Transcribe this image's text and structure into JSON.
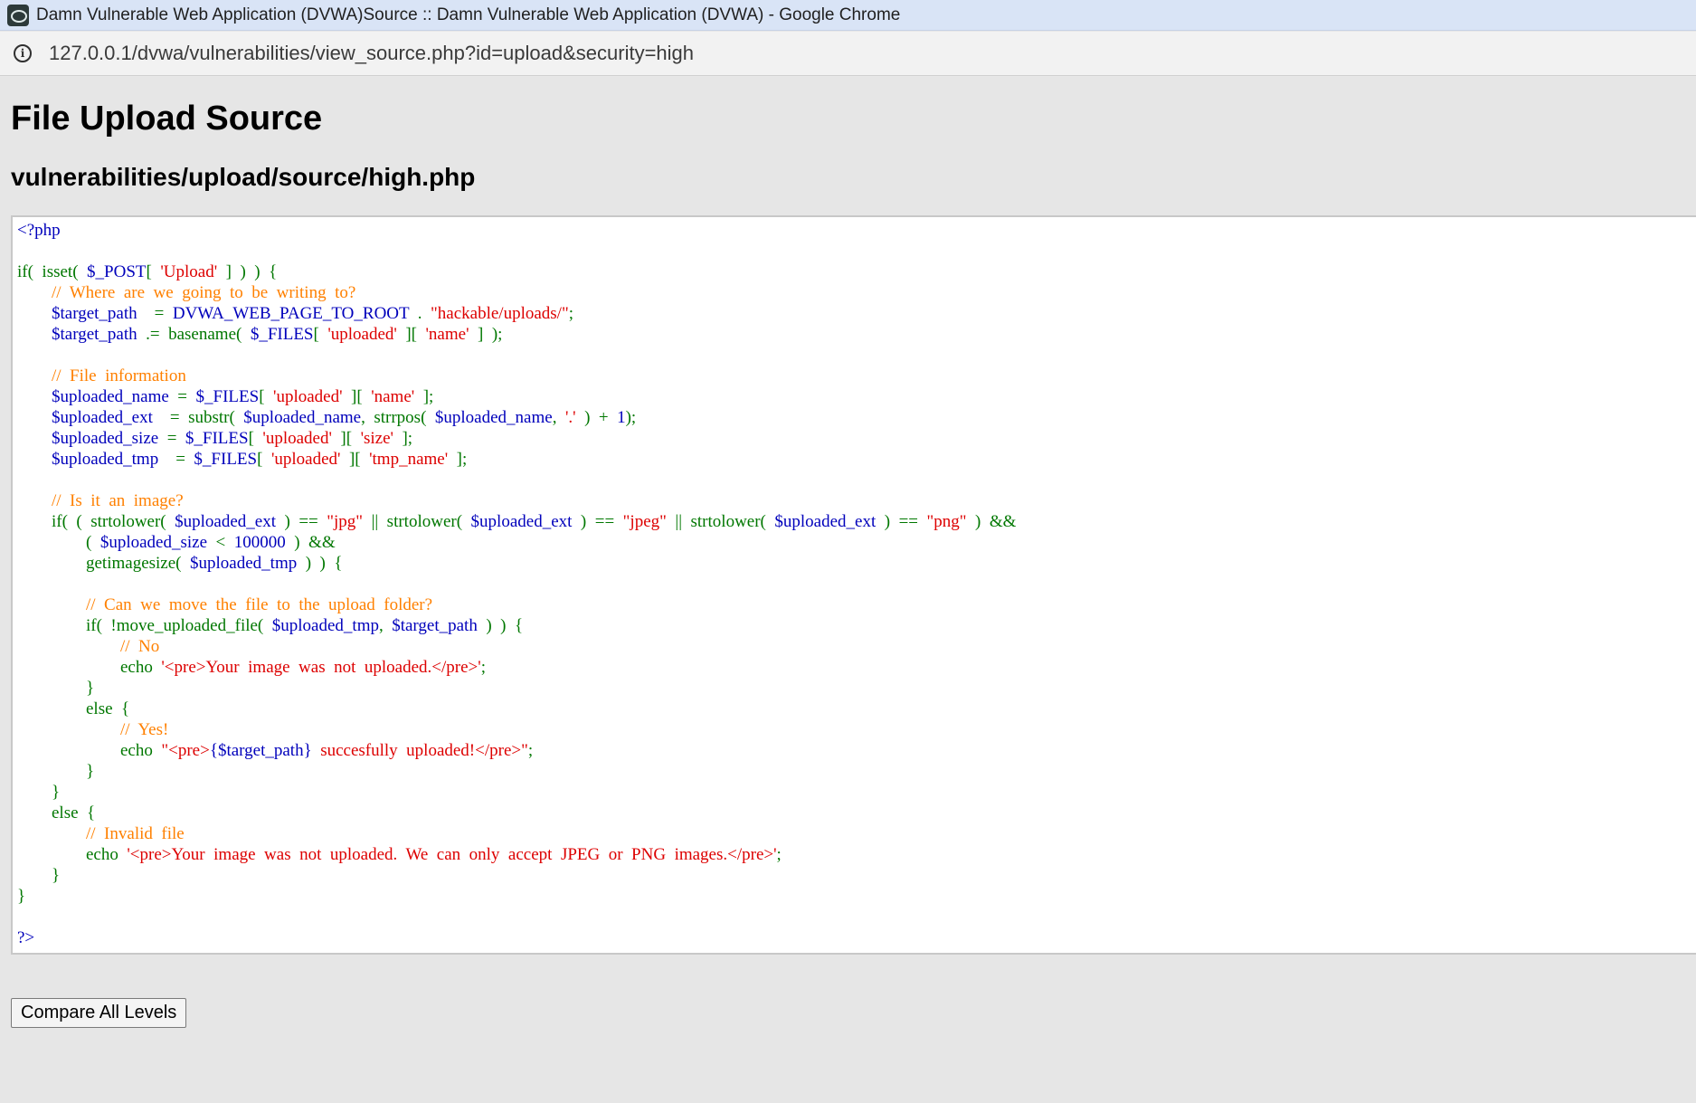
{
  "window": {
    "title": "Damn Vulnerable Web Application (DVWA)Source :: Damn Vulnerable Web Application (DVWA) - Google Chrome"
  },
  "address_bar": {
    "url": "127.0.0.1/dvwa/vulnerabilities/view_source.php?id=upload&security=high"
  },
  "page": {
    "heading": "File Upload Source",
    "subheading": "vulnerabilities/upload/source/high.php",
    "compare_button": "Compare All Levels"
  },
  "source_code": [
    [
      [
        "var",
        "<?php"
      ]
    ],
    [],
    [
      [
        "kw",
        "if(  isset(  "
      ],
      [
        "var",
        "$_POST"
      ],
      [
        "kw",
        "[  "
      ],
      [
        "str",
        "'Upload'"
      ],
      [
        "kw",
        "  ]  )  )  {"
      ]
    ],
    [
      [
        "kw",
        "        "
      ],
      [
        "cm",
        "//  Where  are  we  going  to  be  writing  to?"
      ]
    ],
    [
      [
        "kw",
        "        "
      ],
      [
        "var",
        "$target_path"
      ],
      [
        "kw",
        "    =  "
      ],
      [
        "var",
        "DVWA_WEB_PAGE_TO_ROOT"
      ],
      [
        "kw",
        "  .  "
      ],
      [
        "str",
        "\"hackable/uploads/\""
      ],
      [
        "kw",
        ";"
      ]
    ],
    [
      [
        "kw",
        "        "
      ],
      [
        "var",
        "$target_path"
      ],
      [
        "kw",
        "  .=  basename(  "
      ],
      [
        "var",
        "$_FILES"
      ],
      [
        "kw",
        "[  "
      ],
      [
        "str",
        "'uploaded'"
      ],
      [
        "kw",
        "  ][  "
      ],
      [
        "str",
        "'name'"
      ],
      [
        "kw",
        "  ]  );"
      ]
    ],
    [],
    [
      [
        "kw",
        "        "
      ],
      [
        "cm",
        "//  File  information"
      ]
    ],
    [
      [
        "kw",
        "        "
      ],
      [
        "var",
        "$uploaded_name"
      ],
      [
        "kw",
        "  =  "
      ],
      [
        "var",
        "$_FILES"
      ],
      [
        "kw",
        "[  "
      ],
      [
        "str",
        "'uploaded'"
      ],
      [
        "kw",
        "  ][  "
      ],
      [
        "str",
        "'name'"
      ],
      [
        "kw",
        "  ];"
      ]
    ],
    [
      [
        "kw",
        "        "
      ],
      [
        "var",
        "$uploaded_ext"
      ],
      [
        "kw",
        "    =  substr(  "
      ],
      [
        "var",
        "$uploaded_name"
      ],
      [
        "kw",
        ",  strrpos(  "
      ],
      [
        "var",
        "$uploaded_name"
      ],
      [
        "kw",
        ",  "
      ],
      [
        "str",
        "'.'"
      ],
      [
        "kw",
        "  )  +  "
      ],
      [
        "var",
        "1"
      ],
      [
        "kw",
        ");"
      ]
    ],
    [
      [
        "kw",
        "        "
      ],
      [
        "var",
        "$uploaded_size"
      ],
      [
        "kw",
        "  =  "
      ],
      [
        "var",
        "$_FILES"
      ],
      [
        "kw",
        "[  "
      ],
      [
        "str",
        "'uploaded'"
      ],
      [
        "kw",
        "  ][  "
      ],
      [
        "str",
        "'size'"
      ],
      [
        "kw",
        "  ];"
      ]
    ],
    [
      [
        "kw",
        "        "
      ],
      [
        "var",
        "$uploaded_tmp"
      ],
      [
        "kw",
        "    =  "
      ],
      [
        "var",
        "$_FILES"
      ],
      [
        "kw",
        "[  "
      ],
      [
        "str",
        "'uploaded'"
      ],
      [
        "kw",
        "  ][  "
      ],
      [
        "str",
        "'tmp_name'"
      ],
      [
        "kw",
        "  ];"
      ]
    ],
    [],
    [
      [
        "kw",
        "        "
      ],
      [
        "cm",
        "//  Is  it  an  image?"
      ]
    ],
    [
      [
        "kw",
        "        if(  (  strtolower(  "
      ],
      [
        "var",
        "$uploaded_ext"
      ],
      [
        "kw",
        "  )  ==  "
      ],
      [
        "str",
        "\"jpg\""
      ],
      [
        "kw",
        "  ||  strtolower(  "
      ],
      [
        "var",
        "$uploaded_ext"
      ],
      [
        "kw",
        "  )  ==  "
      ],
      [
        "str",
        "\"jpeg\""
      ],
      [
        "kw",
        "  ||  strtolower(  "
      ],
      [
        "var",
        "$uploaded_ext"
      ],
      [
        "kw",
        "  )  ==  "
      ],
      [
        "str",
        "\"png\""
      ],
      [
        "kw",
        "  )  &&"
      ]
    ],
    [
      [
        "kw",
        "                (  "
      ],
      [
        "var",
        "$uploaded_size"
      ],
      [
        "kw",
        "  <  "
      ],
      [
        "var",
        "100000"
      ],
      [
        "kw",
        "  )  &&"
      ]
    ],
    [
      [
        "kw",
        "                getimagesize(  "
      ],
      [
        "var",
        "$uploaded_tmp"
      ],
      [
        "kw",
        "  )  )  {"
      ]
    ],
    [],
    [
      [
        "kw",
        "                "
      ],
      [
        "cm",
        "//  Can  we  move  the  file  to  the  upload  folder?"
      ]
    ],
    [
      [
        "kw",
        "                if(  !move_uploaded_file(  "
      ],
      [
        "var",
        "$uploaded_tmp"
      ],
      [
        "kw",
        ",  "
      ],
      [
        "var",
        "$target_path"
      ],
      [
        "kw",
        "  )  )  {"
      ]
    ],
    [
      [
        "kw",
        "                        "
      ],
      [
        "cm",
        "//  No"
      ]
    ],
    [
      [
        "kw",
        "                        echo  "
      ],
      [
        "str",
        "'<pre>Your  image  was  not  uploaded.</pre>'"
      ],
      [
        "kw",
        ";"
      ]
    ],
    [
      [
        "kw",
        "                }"
      ]
    ],
    [
      [
        "kw",
        "                else  {"
      ]
    ],
    [
      [
        "kw",
        "                        "
      ],
      [
        "cm",
        "//  Yes!"
      ]
    ],
    [
      [
        "kw",
        "                        echo  "
      ],
      [
        "str",
        "\"<pre>"
      ],
      [
        "var",
        "{$target_path}"
      ],
      [
        "str",
        "  succesfully  uploaded!</pre>\""
      ],
      [
        "kw",
        ";"
      ]
    ],
    [
      [
        "kw",
        "                }"
      ]
    ],
    [
      [
        "kw",
        "        }"
      ]
    ],
    [
      [
        "kw",
        "        else  {"
      ]
    ],
    [
      [
        "kw",
        "                "
      ],
      [
        "cm",
        "//  Invalid  file"
      ]
    ],
    [
      [
        "kw",
        "                echo  "
      ],
      [
        "str",
        "'<pre>Your  image  was  not  uploaded.  We  can  only  accept  JPEG  or  PNG  images.</pre>'"
      ],
      [
        "kw",
        ";"
      ]
    ],
    [
      [
        "kw",
        "        }"
      ]
    ],
    [
      [
        "kw",
        "}"
      ]
    ],
    [],
    [
      [
        "var",
        "?>"
      ]
    ]
  ]
}
